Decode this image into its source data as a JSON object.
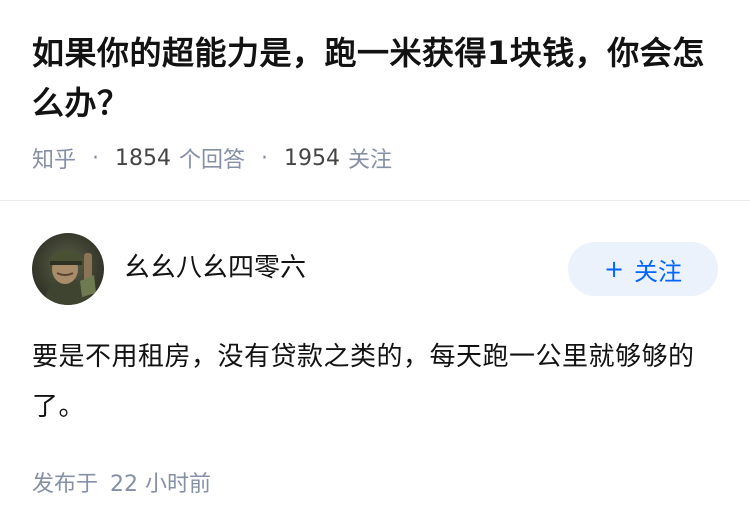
{
  "question": {
    "title": "如果你的超能力是，跑一米获得1块钱，你会怎么办？",
    "source": "知乎",
    "answer_count": "1854",
    "answer_label": "个回答",
    "follower_count": "1954",
    "follower_label": "关注"
  },
  "answer": {
    "author_name": "幺幺八幺四零六",
    "avatar_icon": "user-avatar-photo",
    "follow_button": {
      "icon": "plus-icon",
      "plus": "+",
      "label": "关注"
    },
    "content": "要是不用租房，没有贷款之类的，每天跑一公里就够够的了。",
    "published_prefix": "发布于",
    "published_num": "22",
    "published_unit": "小时前"
  },
  "colors": {
    "title": "#121212",
    "meta": "#8590a6",
    "accent": "#0066ff",
    "follow_bg": "#ebf2fb"
  }
}
